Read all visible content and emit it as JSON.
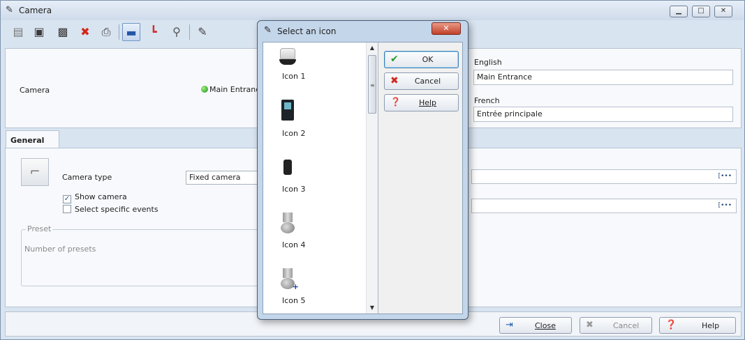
{
  "window": {
    "title": "Camera"
  },
  "top": {
    "camera_label": "Camera",
    "camera_status": "Main Entrance",
    "english_label": "English",
    "english_value": "Main Entrance",
    "french_label": "French",
    "french_value": "Entrée principale"
  },
  "tabs": {
    "general": "General"
  },
  "general": {
    "camera_type_label": "Camera type",
    "camera_type_value": "Fixed camera",
    "show_camera": "Show camera",
    "select_specific_events": "Select specific events",
    "preset_legend": "Preset",
    "number_of_presets": "Number of presets"
  },
  "footer": {
    "close": "Close",
    "cancel": "Cancel",
    "help": "Help"
  },
  "dialog": {
    "title": "Select an icon",
    "icons": [
      "Icon 1",
      "Icon 2",
      "Icon 3",
      "Icon 4",
      "Icon 5"
    ],
    "ok": "OK",
    "cancel": "Cancel",
    "help": "Help"
  },
  "colors": {
    "ok_check": "#2a9a2a",
    "cancel_x": "#d4261b",
    "status_green": "#1f8a1f",
    "dialog_close": "#c2402a"
  }
}
